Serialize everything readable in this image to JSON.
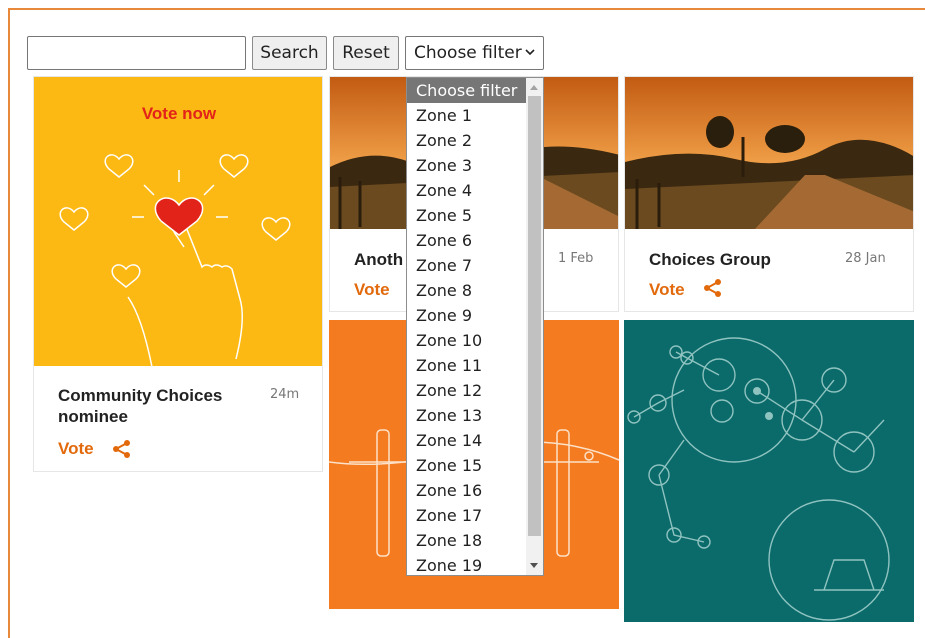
{
  "toolbar": {
    "search_value": "",
    "search_label": "Search",
    "reset_label": "Reset",
    "filter_selected": "Choose filter"
  },
  "filter_options": [
    "Choose filter",
    "Zone 1",
    "Zone 2",
    "Zone 3",
    "Zone 4",
    "Zone 5",
    "Zone 6",
    "Zone 7",
    "Zone 8",
    "Zone 9",
    "Zone 10",
    "Zone 11",
    "Zone 12",
    "Zone 13",
    "Zone 14",
    "Zone 15",
    "Zone 16",
    "Zone 17",
    "Zone 18",
    "Zone 19"
  ],
  "cards": [
    {
      "image_text": "Vote now",
      "title": "Community Choices nominee",
      "time": "24m",
      "vote_label": "Vote"
    },
    {
      "title": "Anoth",
      "time": "1 Feb",
      "vote_label": "Vote"
    },
    {
      "title": "Choices Group",
      "time": "28 Jan",
      "vote_label": "Vote"
    }
  ],
  "colors": {
    "accent": "#e26a0c",
    "frame": "#e8883a",
    "yellow": "#fdb913",
    "orange": "#f47b20",
    "teal": "#0b6b6b"
  }
}
